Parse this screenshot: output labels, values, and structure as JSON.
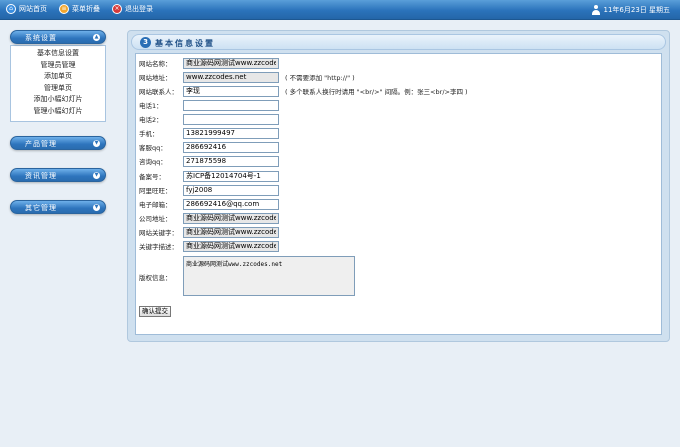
{
  "topbar": {
    "home": "网站首页",
    "menu_toggle": "菜单折叠",
    "logout": "退出登录",
    "datetime": "11年6月23日 星期五"
  },
  "sidebar": {
    "groups": [
      {
        "title": "系统设置",
        "items": [
          "基本信息设置",
          "管理员管理",
          "添加单页",
          "管理单页",
          "添加小幅幻灯片",
          "管理小幅幻灯片"
        ]
      },
      {
        "title": "产品管理"
      },
      {
        "title": "资讯管理"
      },
      {
        "title": "其它管理"
      }
    ]
  },
  "panel": {
    "number": "3",
    "title": "基本信息设置"
  },
  "form": {
    "site_name_label": "网站名称：",
    "site_name": "商业源码网测试www.zzcodes.net",
    "site_url_label": "网站地址：",
    "site_url": "www.zzcodes.net",
    "site_url_note": "( 不需要添加 \"http://\" )",
    "contact_label": "网站联系人：",
    "contact": "李现",
    "contact_note": "( 多个联系人换行时请用 \"<br/>\" 间隔。例：张三<br/>李四 )",
    "phone1_label": "电话1：",
    "phone1": "",
    "phone2_label": "电话2：",
    "phone2": "",
    "mobile_label": "手机：",
    "mobile": "13821999497",
    "qq_label": "客服qq：",
    "qq": "286692416",
    "consult_qq_label": "咨询qq：",
    "consult_qq": "271875598",
    "icp_label": "备案号：",
    "icp": "苏ICP备12014704号-1",
    "wangwang_label": "阿里旺旺：",
    "wangwang": "fyj2008",
    "email_label": "电子邮箱：",
    "email": "286692416@qq.com",
    "address_label": "公司地址：",
    "address": "商业源码网测试www.zzcodes.net",
    "keywords_label": "网站关键字：",
    "keywords": "商业源码网测试www.zzcodes.net",
    "description_label": "关键字描述：",
    "description": "商业源码网测试www.zzcodes.net",
    "copyright_label": "版权信息：",
    "copyright": "商业源码网测试www.zzcodes.net",
    "submit_label": "确认提交"
  }
}
